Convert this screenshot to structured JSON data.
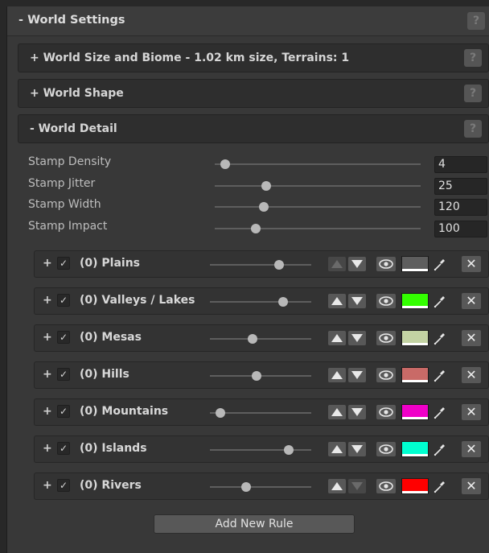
{
  "world_settings": {
    "title": "- World Settings",
    "help": "?"
  },
  "world_size": {
    "label": "+ World Size and Biome - 1.02 km size, Terrains: 1",
    "help": "?"
  },
  "world_shape": {
    "label": "+ World Shape",
    "help": "?"
  },
  "world_detail": {
    "label": "-  World Detail",
    "help": "?",
    "properties": [
      {
        "label": "Stamp Density",
        "value": "4",
        "level": 0.05
      },
      {
        "label": "Stamp Jitter",
        "value": "25",
        "level": 0.25
      },
      {
        "label": "Stamp Width",
        "value": "120",
        "level": 0.24
      },
      {
        "label": "Stamp Impact",
        "value": "100",
        "level": 0.2
      }
    ],
    "rules": [
      {
        "plus": "+",
        "check": "✓",
        "name": "(0) Plains",
        "level": 0.68,
        "color": "#5e5e5e",
        "up_enabled": false,
        "down_enabled": true
      },
      {
        "plus": "+",
        "check": "✓",
        "name": "(0) Valleys / Lakes",
        "level": 0.72,
        "color": "#33ff00",
        "up_enabled": true,
        "down_enabled": true
      },
      {
        "plus": "+",
        "check": "✓",
        "name": "(0) Mesas",
        "level": 0.42,
        "color": "#c3d3a3",
        "up_enabled": true,
        "down_enabled": true
      },
      {
        "plus": "+",
        "check": "✓",
        "name": "(0) Hills",
        "level": 0.46,
        "color": "#c96a67",
        "up_enabled": true,
        "down_enabled": true
      },
      {
        "plus": "+",
        "check": "✓",
        "name": "(0) Mountains",
        "level": 0.1,
        "color": "#f000c8",
        "up_enabled": true,
        "down_enabled": true
      },
      {
        "plus": "+",
        "check": "✓",
        "name": "(0) Islands",
        "level": 0.78,
        "color": "#00ffd0",
        "up_enabled": true,
        "down_enabled": true
      },
      {
        "plus": "+",
        "check": "✓",
        "name": "(0) Rivers",
        "level": 0.36,
        "color": "#ff0000",
        "up_enabled": true,
        "down_enabled": false
      }
    ],
    "add_rule_label": "Add New Rule"
  },
  "icons": {
    "expand": "plus",
    "visibility": "eye-icon",
    "picker": "eyedropper-icon",
    "delete": "close-icon",
    "up": "arrow-up-icon",
    "down": "arrow-down-icon"
  }
}
